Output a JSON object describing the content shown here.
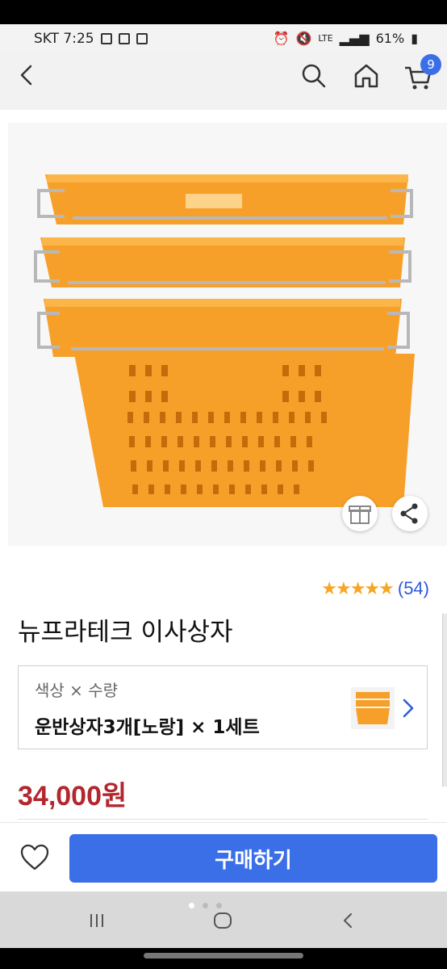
{
  "status": {
    "carrier_time": "SKT 7:25",
    "network": "LTE",
    "battery": "61%"
  },
  "header": {
    "cart_count": "9"
  },
  "product": {
    "rating_stars": "★★★★★",
    "review_count": "(54)",
    "title": "뉴프라테크 이사상자",
    "option_label": "색상 × 수량",
    "option_value": "운반상자3개[노랑] × 1세트",
    "price": "34,000원"
  },
  "actions": {
    "buy_label": "구매하기"
  },
  "colors": {
    "accent": "#3b6fe8",
    "price": "#b3262e",
    "star": "#f5a623",
    "crate": "#f7a029"
  }
}
